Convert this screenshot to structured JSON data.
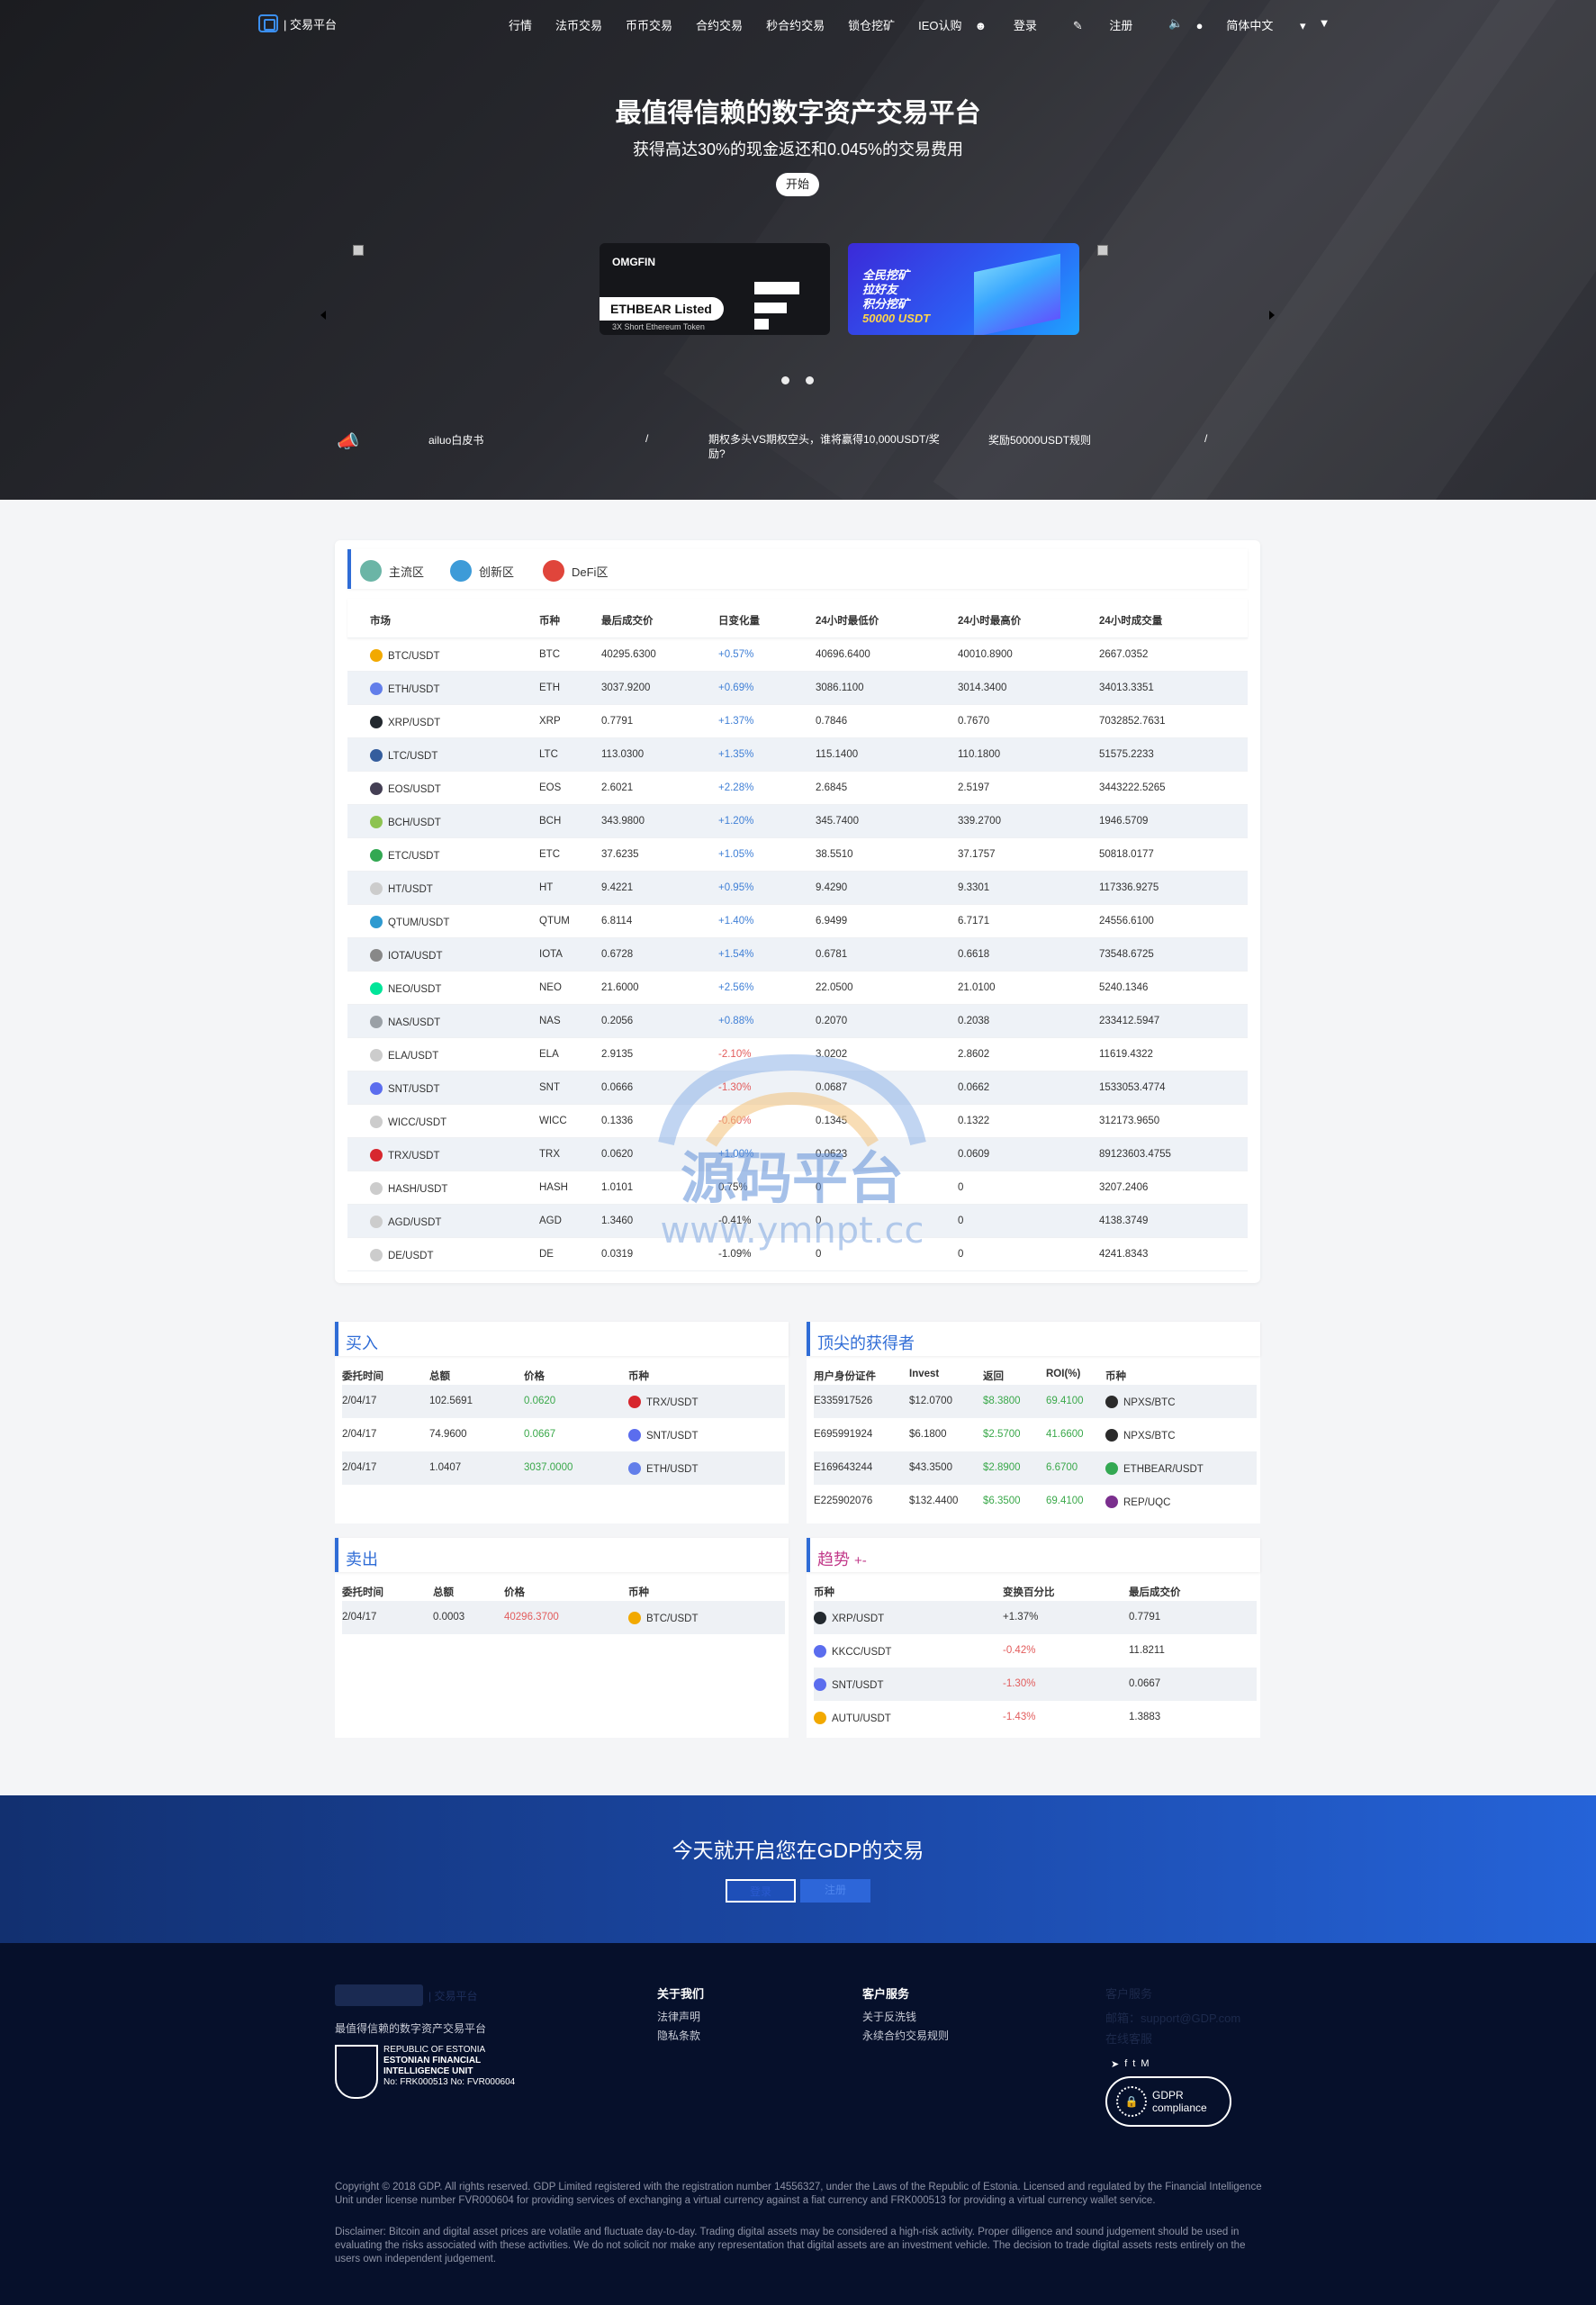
{
  "nav": {
    "logo_text": "| 交易平台",
    "menu": [
      "行情",
      "法币交易",
      "币币交易",
      "合约交易",
      "秒合约交易",
      "锁仓挖矿",
      "IEO认购"
    ],
    "login": "登录",
    "register": "注册",
    "language": "简体中文"
  },
  "hero": {
    "title": "最值得信赖的数字资产交易平台",
    "subtitle": "获得高达30%的现金返还和0.045%的交易费用",
    "start_button": "开始",
    "banner1": {
      "brand": "OMGFIN",
      "listed": "ETHBEAR Listed",
      "caption": "3X Short Ethereum Token"
    },
    "banner2": {
      "lines": [
        "全民挖矿",
        "拉好友",
        "积分挖矿",
        "50000 USDT"
      ]
    }
  },
  "notices": [
    "ailuo白皮书",
    "/",
    "期权多头VS期权空头，谁将赢得10,000USDT/奖励?",
    "奖励50000USDT规则",
    "/"
  ],
  "market_tabs": [
    "主流区",
    "创新区",
    "DeFi区"
  ],
  "market": {
    "headers": [
      "市场",
      "币种",
      "最后成交价",
      "日变化量",
      "24小时最低价",
      "24小时最高价",
      "24小时成交量"
    ],
    "rows": [
      {
        "pair": "BTC/USDT",
        "coin": "BTC",
        "price": "40295.6300",
        "change": "+0.57%",
        "low": "40696.6400",
        "high": "40010.8900",
        "vol": "2667.0352",
        "dir": "up",
        "color": "#f2a900"
      },
      {
        "pair": "ETH/USDT",
        "coin": "ETH",
        "price": "3037.9200",
        "change": "+0.69%",
        "low": "3086.1100",
        "high": "3014.3400",
        "vol": "34013.3351",
        "dir": "up",
        "color": "#627eea"
      },
      {
        "pair": "XRP/USDT",
        "coin": "XRP",
        "price": "0.7791",
        "change": "+1.37%",
        "low": "0.7846",
        "high": "0.7670",
        "vol": "7032852.7631",
        "dir": "up",
        "color": "#23292f"
      },
      {
        "pair": "LTC/USDT",
        "coin": "LTC",
        "price": "113.0300",
        "change": "+1.35%",
        "low": "115.1400",
        "high": "110.1800",
        "vol": "51575.2233",
        "dir": "up",
        "color": "#345d9d"
      },
      {
        "pair": "EOS/USDT",
        "coin": "EOS",
        "price": "2.6021",
        "change": "+2.28%",
        "low": "2.6845",
        "high": "2.5197",
        "vol": "3443222.5265",
        "dir": "up",
        "color": "#443f54"
      },
      {
        "pair": "BCH/USDT",
        "coin": "BCH",
        "price": "343.9800",
        "change": "+1.20%",
        "low": "345.7400",
        "high": "339.2700",
        "vol": "1946.5709",
        "dir": "up",
        "color": "#8dc351"
      },
      {
        "pair": "ETC/USDT",
        "coin": "ETC",
        "price": "37.6235",
        "change": "+1.05%",
        "low": "38.5510",
        "high": "37.1757",
        "vol": "50818.0177",
        "dir": "up",
        "color": "#33a852"
      },
      {
        "pair": "HT/USDT",
        "coin": "HT",
        "price": "9.4221",
        "change": "+0.95%",
        "low": "9.4290",
        "high": "9.3301",
        "vol": "117336.9275",
        "dir": "up",
        "color": "#cccccc"
      },
      {
        "pair": "QTUM/USDT",
        "coin": "QTUM",
        "price": "6.8114",
        "change": "+1.40%",
        "low": "6.9499",
        "high": "6.7171",
        "vol": "24556.6100",
        "dir": "up",
        "color": "#2e9ad0"
      },
      {
        "pair": "IOTA/USDT",
        "coin": "IOTA",
        "price": "0.6728",
        "change": "+1.54%",
        "low": "0.6781",
        "high": "0.6618",
        "vol": "73548.6725",
        "dir": "up",
        "color": "#888888"
      },
      {
        "pair": "NEO/USDT",
        "coin": "NEO",
        "price": "21.6000",
        "change": "+2.56%",
        "low": "22.0500",
        "high": "21.0100",
        "vol": "5240.1346",
        "dir": "up",
        "color": "#00e599"
      },
      {
        "pair": "NAS/USDT",
        "coin": "NAS",
        "price": "0.2056",
        "change": "+0.88%",
        "low": "0.2070",
        "high": "0.2038",
        "vol": "233412.5947",
        "dir": "up",
        "color": "#9aa0a6"
      },
      {
        "pair": "ELA/USDT",
        "coin": "ELA",
        "price": "2.9135",
        "change": "-2.10%",
        "low": "3.0202",
        "high": "2.8602",
        "vol": "11619.4322",
        "dir": "dn",
        "color": "#cccccc"
      },
      {
        "pair": "SNT/USDT",
        "coin": "SNT",
        "price": "0.0666",
        "change": "-1.30%",
        "low": "0.0687",
        "high": "0.0662",
        "vol": "1533053.4774",
        "dir": "dn",
        "color": "#5b6dee"
      },
      {
        "pair": "WICC/USDT",
        "coin": "WICC",
        "price": "0.1336",
        "change": "-0.60%",
        "low": "0.1345",
        "high": "0.1322",
        "vol": "312173.9650",
        "dir": "dn",
        "color": "#cccccc"
      },
      {
        "pair": "TRX/USDT",
        "coin": "TRX",
        "price": "0.0620",
        "change": "+1.00%",
        "low": "0.0623",
        "high": "0.0609",
        "vol": "89123603.4755",
        "dir": "up",
        "color": "#d7272e"
      },
      {
        "pair": "HASH/USDT",
        "coin": "HASH",
        "price": "1.0101",
        "change": "0.75%",
        "low": "0",
        "high": "0",
        "vol": "3207.2406",
        "dir": "flat",
        "color": "#cccccc"
      },
      {
        "pair": "AGD/USDT",
        "coin": "AGD",
        "price": "1.3460",
        "change": "-0.41%",
        "low": "0",
        "high": "0",
        "vol": "4138.3749",
        "dir": "flat",
        "color": "#cccccc"
      },
      {
        "pair": "DE/USDT",
        "coin": "DE",
        "price": "0.0319",
        "change": "-1.09%",
        "low": "0",
        "high": "0",
        "vol": "4241.8343",
        "dir": "flat",
        "color": "#cccccc"
      }
    ]
  },
  "watermark": {
    "main": "源码平台",
    "url": "www.ymnpt.cc"
  },
  "buy": {
    "title": "买入",
    "headers": [
      "委托时间",
      "总额",
      "价格",
      "币种"
    ],
    "rows": [
      {
        "time": "2/04/17",
        "total": "102.5691",
        "price": "0.0620",
        "coin": "TRX/USDT",
        "color": "#d7272e"
      },
      {
        "time": "2/04/17",
        "total": "74.9600",
        "price": "0.0667",
        "coin": "SNT/USDT",
        "color": "#5b6dee"
      },
      {
        "time": "2/04/17",
        "total": "1.0407",
        "price": "3037.0000",
        "coin": "ETH/USDT",
        "color": "#627eea"
      }
    ]
  },
  "sell": {
    "title": "卖出",
    "headers": [
      "委托时间",
      "总额",
      "价格",
      "币种"
    ],
    "rows": [
      {
        "time": "2/04/17",
        "total": "0.0003",
        "price": "40296.3700",
        "coin": "BTC/USDT",
        "color": "#f2a900"
      }
    ]
  },
  "top": {
    "title": "顶尖的获得者",
    "headers": [
      "用户身份证件",
      "Invest",
      "返回",
      "ROI(%)",
      "币种"
    ],
    "rows": [
      {
        "id": "E335917526",
        "invest": "$12.0700",
        "ret": "$8.3800",
        "roi": "69.4100",
        "coin": "NPXS/BTC",
        "color": "#2b2b2b"
      },
      {
        "id": "E695991924",
        "invest": "$6.1800",
        "ret": "$2.5700",
        "roi": "41.6600",
        "coin": "NPXS/BTC",
        "color": "#2b2b2b"
      },
      {
        "id": "E169643244",
        "invest": "$43.3500",
        "ret": "$2.8900",
        "roi": "6.6700",
        "coin": "ETHBEAR/USDT",
        "color": "#33a852"
      },
      {
        "id": "E225902076",
        "invest": "$132.4400",
        "ret": "$6.3500",
        "roi": "69.4100",
        "coin": "REP/UQC",
        "color": "#7b2f8e"
      }
    ]
  },
  "trend": {
    "title": "趋势",
    "title_suffix": "+-",
    "headers": [
      "币种",
      "变换百分比",
      "最后成交价"
    ],
    "rows": [
      {
        "coin": "XRP/USDT",
        "pct": "+1.37%",
        "price": "0.7791",
        "dir": "up",
        "color": "#23292f"
      },
      {
        "coin": "KKCC/USDT",
        "pct": "-0.42%",
        "price": "11.8211",
        "dir": "dn",
        "color": "#5b6dee"
      },
      {
        "coin": "SNT/USDT",
        "pct": "-1.30%",
        "price": "0.0667",
        "dir": "dn",
        "color": "#5b6dee"
      },
      {
        "coin": "AUTU/USDT",
        "pct": "-1.43%",
        "price": "1.3883",
        "dir": "dn",
        "color": "#f2a900"
      }
    ]
  },
  "cta": {
    "title": "今天就开启您在GDP的交易",
    "login": "登录",
    "register": "注册"
  },
  "footer": {
    "brand_suffix": "| 交易平台",
    "tagline": "最值得信赖的数字资产交易平台",
    "estonia": {
      "l1": "REPUBLIC OF ESTONIA",
      "l2": "ESTONIAN FINANCIAL",
      "l3": "INTELLIGENCE UNIT",
      "l4": "No: FRK000513 No: FVR000604"
    },
    "about_title": "关于我们",
    "about": [
      "法律声明",
      "隐私条款"
    ],
    "service_title": "客户服务",
    "service": [
      "关于反洗钱",
      "永续合约交易规则"
    ],
    "contact_title": "客户服务",
    "contact": [
      "邮箱：support@GDP.com",
      "在线客服"
    ],
    "gdpr": "GDPR compliance",
    "copyright": "Copyright © 2018 GDP. All rights reserved. GDP Limited registered with the registration number 14556327, under the Laws of the Republic of Estonia. Licensed and regulated by the Financial Intelligence Unit under license number FVR000604 for providing services of exchanging a virtual currency against a fiat currency and FRK000513 for providing a virtual currency wallet service.",
    "disclaimer": "Disclaimer: Bitcoin and digital asset prices are volatile and fluctuate day-to-day. Trading digital assets may be considered a high-risk activity. Proper diligence and sound judgement should be used in evaluating the risks associated with these activities. We do not solicit nor make any representation that digital assets are an investment vehicle. The decision to trade digital assets rests entirely on the users own independent judgement."
  }
}
